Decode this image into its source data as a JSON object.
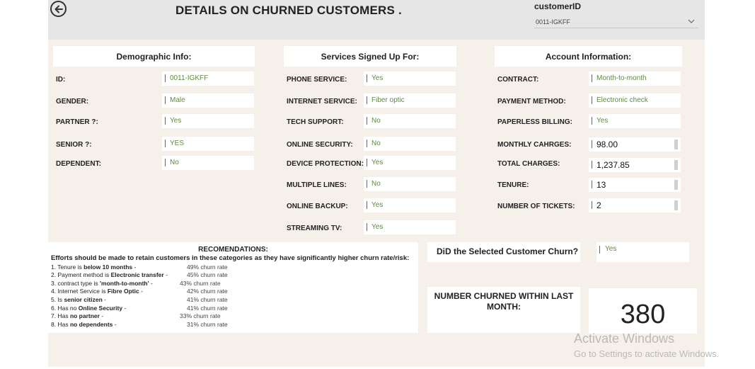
{
  "header": {
    "title": "DETAILS ON CHURNED CUSTOMERS .",
    "slicer_label": "customerID",
    "slicer_value": "0011-IGKFF"
  },
  "demographic": {
    "heading": "Demographic Info:",
    "fields": [
      {
        "label": "ID:",
        "value": "0011-IGKFF"
      },
      {
        "label": "GENDER:",
        "value": "Male"
      },
      {
        "label": "PARTNER ?:",
        "value": "Yes"
      },
      {
        "label": "SENIOR ?:",
        "value": "YES"
      },
      {
        "label": "DEPENDENT:",
        "value": "No"
      }
    ]
  },
  "services": {
    "heading": "Services Signed Up For:",
    "fields": [
      {
        "label": "PHONE SERVICE:",
        "value": "Yes"
      },
      {
        "label": "INTERNET SERVICE:",
        "value": "Fiber optic"
      },
      {
        "label": "TECH SUPPORT:",
        "value": "No"
      },
      {
        "label": "ONLINE SECURITY:",
        "value": "No"
      },
      {
        "label": "DEVICE PROTECTION:",
        "value": "Yes"
      },
      {
        "label": "MULTIPLE LINES:",
        "value": "No"
      },
      {
        "label": "ONLINE BACKUP:",
        "value": "Yes"
      },
      {
        "label": "STREAMING TV:",
        "value": "Yes"
      }
    ]
  },
  "account": {
    "heading": "Account Information:",
    "fields": [
      {
        "label": "CONTRACT:",
        "value": "Month-to-month"
      },
      {
        "label": "PAYMENT METHOD:",
        "value": "Electronic check"
      },
      {
        "label": "PAPERLESS BILLING:",
        "value": "Yes"
      },
      {
        "label": "MONTHLY CAHRGES:",
        "value": "98.00"
      },
      {
        "label": "TOTAL CHARGES:",
        "value": "1,237.85"
      },
      {
        "label": "TENURE:",
        "value": "13"
      },
      {
        "label": "NUMBER OF TICKETS:",
        "value": "2"
      }
    ]
  },
  "recommendations": {
    "title": "RECOMENDATIONS:",
    "intro": "Efforts should be made to retain customers in these categories as they have significantly higher churn rate/risk:",
    "items": [
      {
        "prefix": "1. Tenure is ",
        "bold": "below 10 months",
        "suffix": " -",
        "rate": "49% churn rate"
      },
      {
        "prefix": "2. Payment method is ",
        "bold": "Electronic transfer",
        "suffix": " -",
        "rate": "45% churn rate"
      },
      {
        "prefix": "3. contract type is ",
        "bold": "'month-to-month'",
        "suffix": " -",
        "rate": "43% churn rate"
      },
      {
        "prefix": "4. Internet Service is ",
        "bold": "Fibre Optic",
        "suffix": " -",
        "rate": "42% churn rate"
      },
      {
        "prefix": "5. Is ",
        "bold": "senior citizen",
        "suffix": " -",
        "rate": "41% churn rate"
      },
      {
        "prefix": "6. Has no ",
        "bold": "Online Security",
        "suffix": " -",
        "rate": "41% churn rate"
      },
      {
        "prefix": "7. Has ",
        "bold": "no partner",
        "suffix": " -",
        "rate": "33% churn rate"
      },
      {
        "prefix": "8. Has ",
        "bold": "no dependents",
        "suffix": " -",
        "rate": "31% churn rate"
      }
    ]
  },
  "churn_question": {
    "text": "DiD the Selected Customer Churn?",
    "answer": "Yes"
  },
  "churned_last_month": {
    "label": "NUMBER  CHURNED WITHIN LAST MONTH:",
    "value": "380"
  },
  "watermark": {
    "line1": "Activate Windows",
    "line2": "Go to Settings to activate Windows."
  },
  "colors": {
    "canvas": "#f6f0ea",
    "header": "#e6e6e6",
    "value_text": "#5b8c3c"
  }
}
